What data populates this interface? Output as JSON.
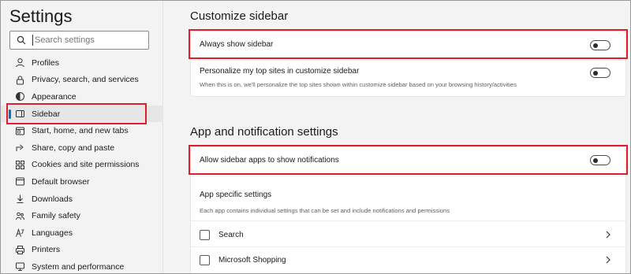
{
  "sidebar": {
    "title": "Settings",
    "search_placeholder": "Search settings",
    "items": [
      {
        "label": "Profiles",
        "icon": "profile-icon"
      },
      {
        "label": "Privacy, search, and services",
        "icon": "lock-icon"
      },
      {
        "label": "Appearance",
        "icon": "appearance-icon"
      },
      {
        "label": "Sidebar",
        "icon": "sidebar-icon",
        "active": true
      },
      {
        "label": "Start, home, and new tabs",
        "icon": "home-icon"
      },
      {
        "label": "Share, copy and paste",
        "icon": "share-icon"
      },
      {
        "label": "Cookies and site permissions",
        "icon": "cookies-icon"
      },
      {
        "label": "Default browser",
        "icon": "browser-icon"
      },
      {
        "label": "Downloads",
        "icon": "download-icon"
      },
      {
        "label": "Family safety",
        "icon": "family-icon"
      },
      {
        "label": "Languages",
        "icon": "languages-icon"
      },
      {
        "label": "Printers",
        "icon": "printer-icon"
      },
      {
        "label": "System and performance",
        "icon": "system-icon"
      }
    ]
  },
  "customize": {
    "heading": "Customize sidebar",
    "always_show_label": "Always show sidebar",
    "always_show_on": false,
    "personalize_label": "Personalize my top sites in customize sidebar",
    "personalize_desc": "When this is on, we'll personalize the top sites shown within customize sidebar based on your browsing history/activities",
    "personalize_on": false
  },
  "apps": {
    "heading": "App and notification settings",
    "allow_notifications_label": "Allow sidebar apps to show notifications",
    "allow_notifications_on": false,
    "specific_title": "App specific settings",
    "specific_desc": "Each app contains individual settings that can be set and include notifications and permissions",
    "app_items": [
      {
        "label": "Search"
      },
      {
        "label": "Microsoft Shopping"
      }
    ]
  },
  "colors": {
    "highlight": "#e01d2a",
    "accent": "#0f6cbd"
  }
}
